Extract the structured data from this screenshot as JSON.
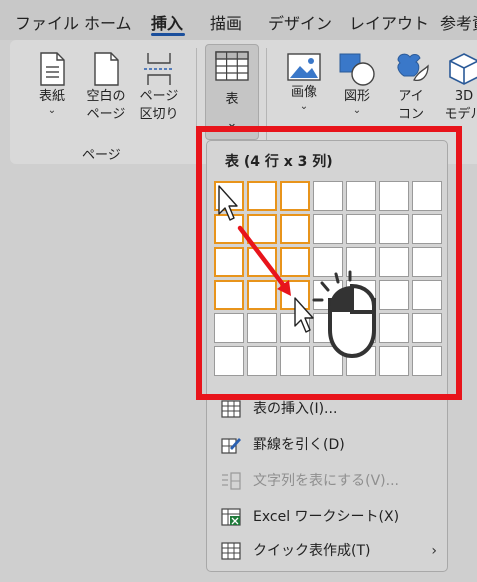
{
  "ribbon": {
    "tabs": [
      "ファイル",
      "ホーム",
      "挿入",
      "描画",
      "デザイン",
      "レイアウト",
      "参考資"
    ],
    "active_tab_index": 2,
    "page_group": {
      "label": "ページ",
      "buttons": [
        {
          "line1": "表紙",
          "line2": "",
          "icon": "cover-page-icon",
          "has_dropdown": true
        },
        {
          "line1": "空白の",
          "line2": "ページ",
          "icon": "blank-page-icon",
          "has_dropdown": false
        },
        {
          "line1": "ページ",
          "line2": "区切り",
          "icon": "page-break-icon",
          "has_dropdown": false
        }
      ]
    },
    "table_button": {
      "label": "表",
      "icon": "table-grid-icon"
    },
    "illustrations": [
      {
        "line1": "画像",
        "icon": "picture-icon"
      },
      {
        "line1": "図形",
        "icon": "shapes-icon"
      },
      {
        "line1": "アイ",
        "line2": "コン",
        "icon": "icons-bird-icon"
      },
      {
        "line1": "3D",
        "line2": "モデル",
        "icon": "3d-model-icon"
      }
    ]
  },
  "table_dropdown": {
    "title": "表 (4 行 x 3 列)",
    "grid_cols": 7,
    "grid_rows": 6,
    "selected_rows": 4,
    "selected_cols": 3,
    "menu": [
      {
        "label": "表の挿入(I)...",
        "icon": "insert-table-icon",
        "enabled": true
      },
      {
        "label": "罫線を引く(D)",
        "icon": "draw-table-icon",
        "enabled": true
      },
      {
        "label": "文字列を表にする(V)...",
        "icon": "convert-text-icon",
        "enabled": false
      },
      {
        "label": "Excel ワークシート(X)",
        "icon": "excel-sheet-icon",
        "enabled": true
      },
      {
        "label": "クイック表作成(T)",
        "icon": "quick-table-icon",
        "enabled": true,
        "submenu": true
      }
    ]
  },
  "annotation": {
    "highlight_color": "#e8141b",
    "arrow_color": "#e8141b",
    "cursor_icons": [
      "pointer-arrow-icon",
      "mouse-click-icon"
    ]
  }
}
